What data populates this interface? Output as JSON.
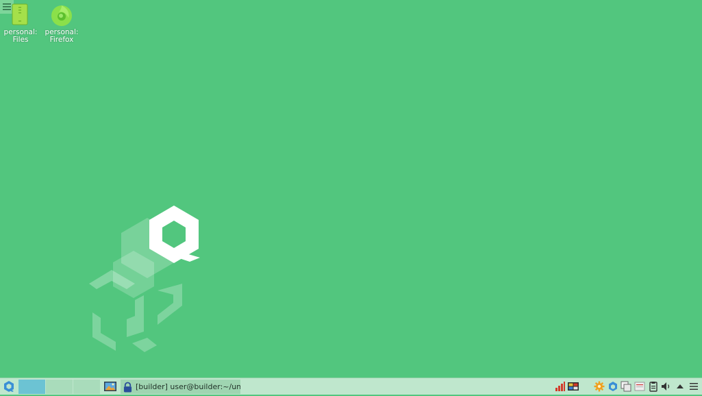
{
  "desktop": {
    "background_color": "#52c67e",
    "corner_menu_icon": "hamburger-icon",
    "icons": [
      {
        "label_line1": "personal:",
        "label_line2": "Files",
        "icon": "files-icon"
      },
      {
        "label_line1": "personal:",
        "label_line2": "Firefox",
        "icon": "firefox-icon"
      }
    ],
    "wallpaper_logo": "qubes-logo"
  },
  "taskbar": {
    "app_menu_icon": "qubes-menu-icon",
    "workspaces": [
      "workspace-1",
      "workspace-2",
      "workspace-3"
    ],
    "active_workspace": 1,
    "show_desktop_icon": "show-desktop-icon",
    "window_button": {
      "icon": "lock-icon",
      "title": "[builder] user@builder:~/un..."
    },
    "tray_icons": [
      "network-icon",
      "qube-manager-icon",
      "updates-icon",
      "qubes-domains-icon",
      "devices-icon",
      "clipboard-icon",
      "disk-icon",
      "volume-icon",
      "arrow-up-icon",
      "menu-icon"
    ],
    "accent_color": "#6cc3d3"
  }
}
